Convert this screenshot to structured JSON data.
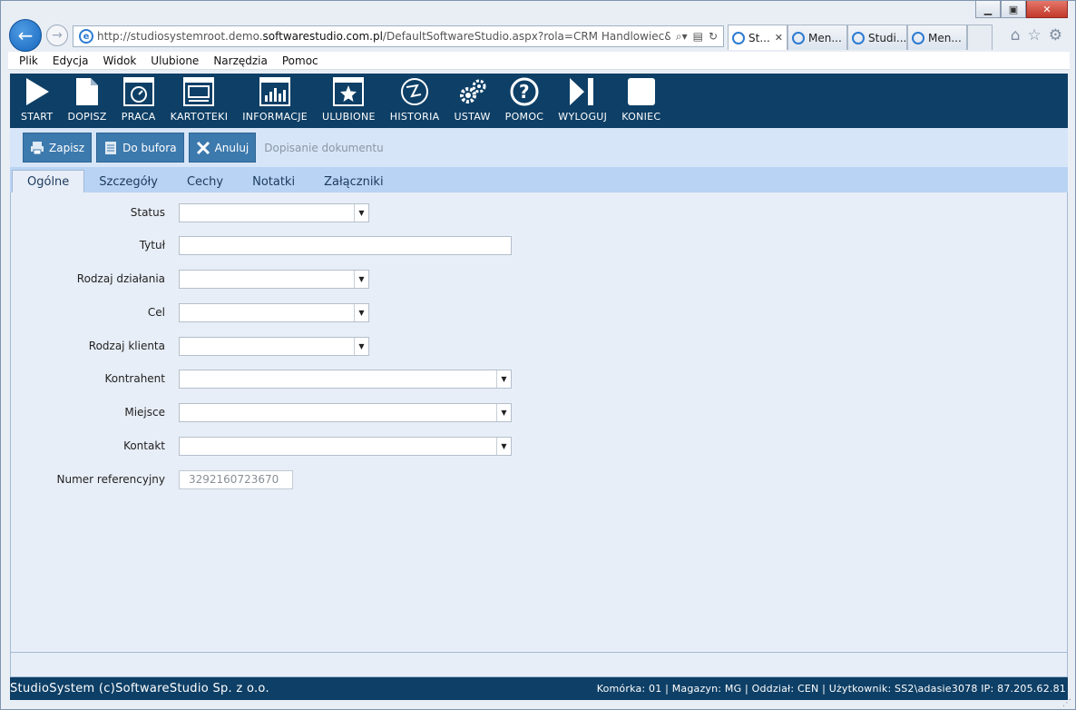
{
  "browser": {
    "url_prefix": "http://studiosystemroot.demo.",
    "url_host": "softwarestudio.com.pl",
    "url_rest": "/DefaultSoftwareStudio.aspx?rola=CRM Handlowiec&rolasys=CF",
    "tabs": [
      {
        "label": "St...",
        "active": true
      },
      {
        "label": "Men...",
        "active": false
      },
      {
        "label": "Studi...",
        "active": false
      },
      {
        "label": "Men...",
        "active": false
      }
    ],
    "tab_close": "✕",
    "icons": [
      "home-icon",
      "favorites-star-icon",
      "tools-gear-icon"
    ]
  },
  "menu": [
    "Plik",
    "Edycja",
    "Widok",
    "Ulubione",
    "Narzędzia",
    "Pomoc"
  ],
  "toolbar": [
    {
      "label": "START",
      "icon": "play-icon"
    },
    {
      "label": "DOPISZ",
      "icon": "new-document-icon"
    },
    {
      "label": "PRACA",
      "icon": "work-gauge-icon"
    },
    {
      "label": "KARTOTEKI",
      "icon": "files-window-icon"
    },
    {
      "label": "INFORMACJE",
      "icon": "chart-icon"
    },
    {
      "label": "ULUBIONE",
      "icon": "favorite-star-icon"
    },
    {
      "label": "HISTORIA",
      "icon": "history-icon"
    },
    {
      "label": "USTAW",
      "icon": "settings-gears-icon"
    },
    {
      "label": "POMOC",
      "icon": "help-icon"
    },
    {
      "label": "WYLOGUJ",
      "icon": "logout-icon"
    },
    {
      "label": "KONIEC",
      "icon": "exit-square-icon"
    }
  ],
  "actions": {
    "save": "Zapisz",
    "buffer": "Do bufora",
    "cancel": "Anuluj",
    "title": "Dopisanie dokumentu"
  },
  "form_tabs": [
    {
      "label": "Ogólne",
      "active": true
    },
    {
      "label": "Szczegóły",
      "active": false
    },
    {
      "label": "Cechy",
      "active": false
    },
    {
      "label": "Notatki",
      "active": false
    },
    {
      "label": "Załączniki",
      "active": false
    }
  ],
  "form": {
    "status": {
      "label": "Status",
      "value": ""
    },
    "tytul": {
      "label": "Tytuł",
      "value": ""
    },
    "rodzaj_dzialania": {
      "label": "Rodzaj działania",
      "value": ""
    },
    "cel": {
      "label": "Cel",
      "value": ""
    },
    "rodzaj_klienta": {
      "label": "Rodzaj klienta",
      "value": ""
    },
    "kontrahent": {
      "label": "Kontrahent",
      "value": ""
    },
    "miejsce": {
      "label": "Miejsce",
      "value": ""
    },
    "kontakt": {
      "label": "Kontakt",
      "value": ""
    },
    "numer_ref": {
      "label": "Numer referencyjny",
      "value": "3292160723670"
    }
  },
  "status": {
    "left": "StudioSystem (c)SoftwareStudio Sp. z o.o.",
    "right": "Komórka: 01 | Magazyn: MG | Oddział: CEN | Użytkownik: SS2\\adasie3078 IP: 87.205.62.81"
  }
}
